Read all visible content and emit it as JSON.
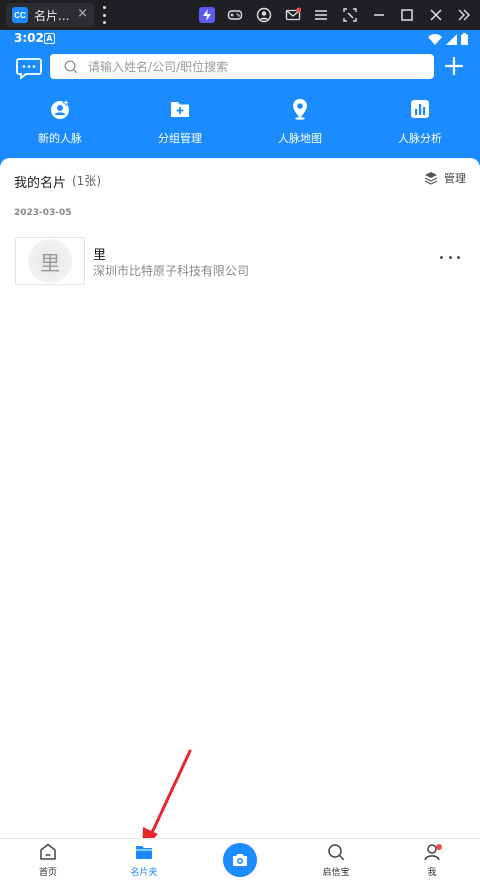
{
  "emulator": {
    "tab_title": "名片...",
    "app_icon_text": "CC",
    "close_glyph": "×"
  },
  "status_bar": {
    "time": "3:02",
    "notif_letter": "A"
  },
  "header": {
    "search_placeholder": "请输入姓名/公司/职位搜索",
    "quick_actions": [
      {
        "label": "新的人脉",
        "icon": "new-contacts-icon"
      },
      {
        "label": "分组管理",
        "icon": "group-folder-icon"
      },
      {
        "label": "人脉地图",
        "icon": "map-pin-icon"
      },
      {
        "label": "人脉分析",
        "icon": "analytics-chart-icon"
      }
    ]
  },
  "cards_section": {
    "title": "我的名片",
    "count": "(1张)",
    "manage_label": "管理",
    "date": "2023-03-05",
    "cards": [
      {
        "avatar_char": "里",
        "name": "里",
        "company": "深圳市比特原子科技有限公司"
      }
    ]
  },
  "bottom_nav": {
    "items": [
      {
        "label": "首页",
        "icon": "home-icon"
      },
      {
        "label": "名片夹",
        "icon": "card-folder-icon",
        "active": true
      },
      {
        "label": "",
        "icon": "camera-icon"
      },
      {
        "label": "启信宝",
        "icon": "search-icon"
      },
      {
        "label": "我",
        "icon": "profile-icon"
      }
    ]
  },
  "colors": {
    "brand": "#1a8cff",
    "annotation": "#e8262e",
    "badge": "#f04a4a"
  }
}
